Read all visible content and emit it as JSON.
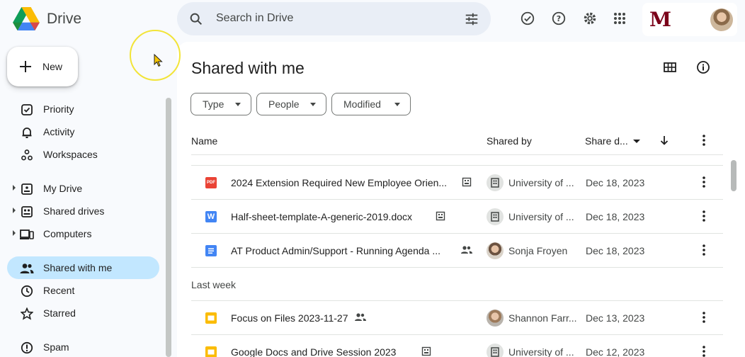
{
  "app": {
    "name": "Drive"
  },
  "search": {
    "placeholder": "Search in Drive"
  },
  "header_icons": [
    "ready-for-offline-icon",
    "help-icon",
    "settings-icon",
    "apps-grid-icon"
  ],
  "sidebar": {
    "new_label": "New",
    "items": [
      {
        "label": "Priority",
        "icon": "priority-icon",
        "expandable": false,
        "active": false
      },
      {
        "label": "Activity",
        "icon": "bell-icon",
        "expandable": false,
        "active": false
      },
      {
        "label": "Workspaces",
        "icon": "workspaces-icon",
        "expandable": false,
        "active": false
      },
      {
        "label": "My Drive",
        "icon": "my-drive-icon",
        "expandable": true,
        "active": false
      },
      {
        "label": "Shared drives",
        "icon": "shared-drives-icon",
        "expandable": true,
        "active": false
      },
      {
        "label": "Computers",
        "icon": "computers-icon",
        "expandable": true,
        "active": false
      },
      {
        "label": "Shared with me",
        "icon": "people-icon",
        "expandable": false,
        "active": true
      },
      {
        "label": "Recent",
        "icon": "clock-icon",
        "expandable": false,
        "active": false
      },
      {
        "label": "Starred",
        "icon": "star-icon",
        "expandable": false,
        "active": false
      },
      {
        "label": "Spam",
        "icon": "spam-icon",
        "expandable": false,
        "active": false
      }
    ]
  },
  "main": {
    "title": "Shared with me",
    "filters": [
      "Type",
      "People",
      "Modified"
    ],
    "columns": {
      "name": "Name",
      "shared_by": "Shared by",
      "share_date": "Share d..."
    },
    "rows": [
      {
        "type": "pdf",
        "type_label": "PDF",
        "name": "2024 Extension Required New Employee Orien...",
        "badge": "shared-with-org-icon",
        "shared_by": "University of ...",
        "sharer_avatar": "building-icon",
        "date": "Dec 18, 2023"
      },
      {
        "type": "word",
        "type_label": "W",
        "name": "Half-sheet-template-A-generic-2019.docx",
        "badge": "shared-with-org-icon",
        "shared_by": "University of ...",
        "sharer_avatar": "building-icon",
        "date": "Dec 18, 2023"
      },
      {
        "type": "docs",
        "type_label": "",
        "name": "AT Product Admin/Support - Running Agenda ...",
        "badge": "shared-people-icon",
        "shared_by": "Sonja Froyen",
        "sharer_avatar": "person-photo",
        "date": "Dec 18, 2023"
      }
    ],
    "section_label": "Last week",
    "rows_last_week": [
      {
        "type": "slides",
        "type_label": "",
        "name": "Focus on Files 2023-11-27",
        "badge": "shared-people-icon",
        "shared_by": "Shannon Farr...",
        "sharer_avatar": "person-photo",
        "date": "Dec 13, 2023"
      },
      {
        "type": "slides",
        "type_label": "",
        "name": "Google Docs and Drive Session 2023",
        "badge": "shared-with-org-icon",
        "shared_by": "University of ...",
        "sharer_avatar": "building-icon",
        "date": "Dec 12, 2023"
      }
    ]
  },
  "colors": {
    "accent_active": "#c2e7ff",
    "pdf": "#ea4335",
    "word": "#4285f4",
    "docs": "#4285f4",
    "slides": "#fbbc04",
    "brand_maroon": "#7a0019"
  }
}
